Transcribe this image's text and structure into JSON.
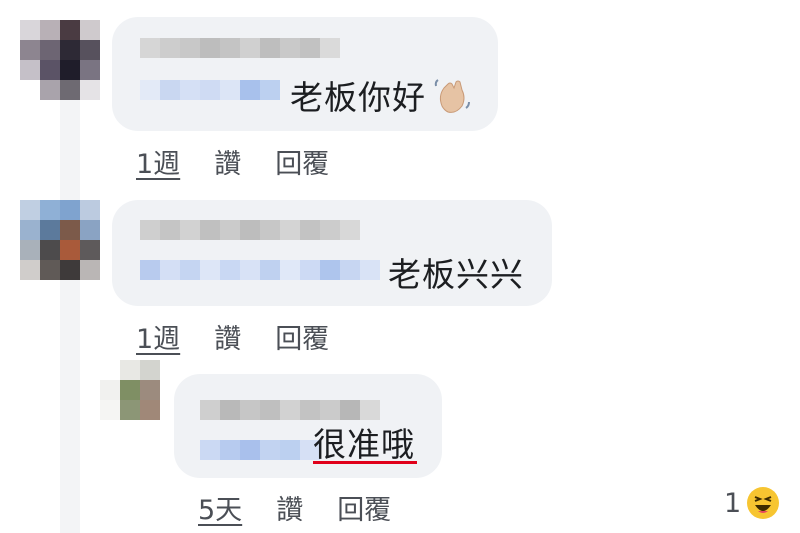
{
  "comments": [
    {
      "text": "老板你好",
      "time": "1週",
      "like_label": "讚",
      "reply_label": "回覆"
    },
    {
      "text": "老板兴兴",
      "time": "1週",
      "like_label": "讚",
      "reply_label": "回覆"
    },
    {
      "text": "很准哦",
      "time": "5天",
      "like_label": "讚",
      "reply_label": "回覆",
      "reaction_count": "1"
    }
  ],
  "icons": {
    "wave": "waving-hand-icon",
    "reaction": "laughing-face-icon"
  },
  "colors": {
    "bubble": "#f0f2f5",
    "underline": "#e0001a",
    "reaction": "#f7c531"
  }
}
